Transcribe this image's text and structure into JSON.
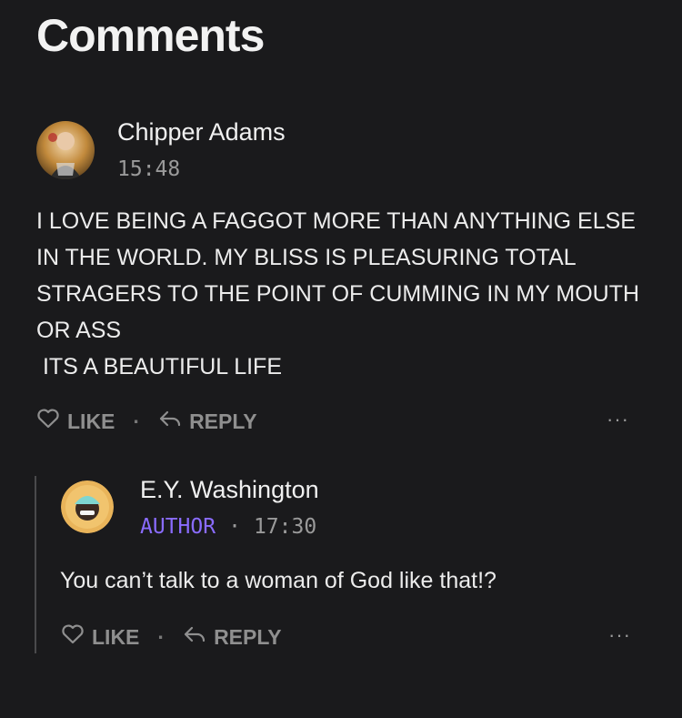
{
  "page": {
    "title": "Comments"
  },
  "comments": [
    {
      "author": "Chipper Adams",
      "timestamp": "15:48",
      "text": "I LOVE BEING A FAGGOT MORE THAN ANYTHING ELSE IN THE WORLD. MY BLISS IS PLEASURING TOTAL STRAGERS TO THE POINT OF CUMMING IN MY MOUTH OR ASS\n ITS A BEAUTIFUL LIFE",
      "like_label": "LIKE",
      "reply_label": "REPLY",
      "separator": "·",
      "more_label": "···"
    }
  ],
  "replies": [
    {
      "author": "E.Y. Washington",
      "badge": "AUTHOR",
      "separator": "·",
      "timestamp": "17:30",
      "text": "You can’t talk to a woman of God like that!?",
      "like_label": "LIKE",
      "reply_label": "REPLY",
      "action_separator": "·",
      "more_label": "···"
    }
  ],
  "colors": {
    "background": "#1a1a1c",
    "author_badge": "#8a6cff",
    "muted": "#8f8f8f"
  },
  "icons": [
    "heart-icon",
    "reply-arrow-icon",
    "more-options-icon"
  ]
}
